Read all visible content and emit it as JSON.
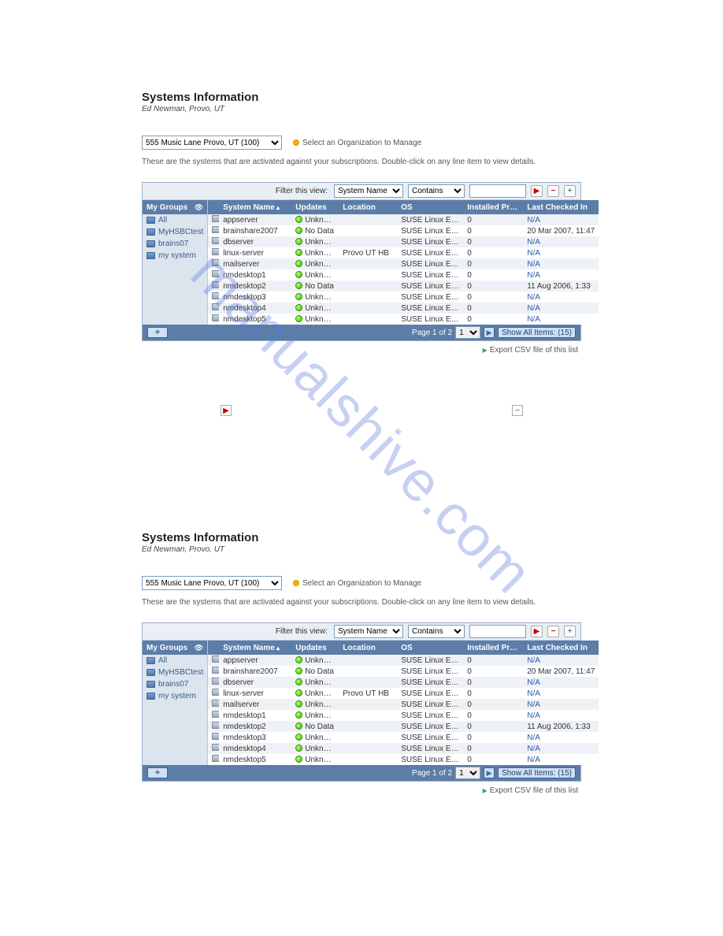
{
  "watermark": "manualshive.com",
  "header": {
    "title": "Systems Information",
    "subtitle": "Ed Newman, Provo, UT"
  },
  "org": {
    "selected": "555 Music Lane Provo, UT (100)",
    "hint": "Select an Organization to Manage"
  },
  "description": "These are the systems that are activated against your subscriptions. Double-click on any line item to view details.",
  "filter": {
    "label": "Filter this view:",
    "field": "System Name",
    "op": "Contains",
    "value": ""
  },
  "sidebar": {
    "title": "My Groups",
    "items": [
      "All",
      "MyHSBCtest",
      "brains07",
      "my system"
    ]
  },
  "columns": {
    "name": "System Name",
    "updates": "Updates",
    "location": "Location",
    "os": "OS",
    "products": "Installed Products",
    "last": "Last Checked In"
  },
  "rows": [
    {
      "name": "appserver",
      "updates": "Unknown",
      "location": "",
      "os": "SUSE Linux Enterp...",
      "products": "0",
      "last": "N/A"
    },
    {
      "name": "brainshare2007",
      "updates": "No Data",
      "location": "",
      "os": "SUSE Linux Enterp...",
      "products": "0",
      "last": "20 Mar 2007, 11:47"
    },
    {
      "name": "dbserver",
      "updates": "Unknown",
      "location": "",
      "os": "SUSE Linux Enterp...",
      "products": "0",
      "last": "N/A"
    },
    {
      "name": "linux-server",
      "updates": "Unknown",
      "location": "Provo UT HB",
      "os": "SUSE Linux Enterp...",
      "products": "0",
      "last": "N/A"
    },
    {
      "name": "mailserver",
      "updates": "Unknown",
      "location": "",
      "os": "SUSE Linux Enterp...",
      "products": "0",
      "last": "N/A"
    },
    {
      "name": "nmdesktop1",
      "updates": "Unknown",
      "location": "",
      "os": "SUSE Linux Enterp...",
      "products": "0",
      "last": "N/A"
    },
    {
      "name": "nmdesktop2",
      "updates": "No Data",
      "location": "",
      "os": "SUSE Linux Enterp...",
      "products": "0",
      "last": "11 Aug 2006, 1:33"
    },
    {
      "name": "nmdesktop3",
      "updates": "Unknown",
      "location": "",
      "os": "SUSE Linux Enterp...",
      "products": "0",
      "last": "N/A"
    },
    {
      "name": "nmdesktop4",
      "updates": "Unknown",
      "location": "",
      "os": "SUSE Linux Enterp...",
      "products": "0",
      "last": "N/A"
    },
    {
      "name": "nmdesktop5",
      "updates": "Unknown",
      "location": "",
      "os": "SUSE Linux Enterp...",
      "products": "0",
      "last": "N/A"
    }
  ],
  "pager": {
    "text": "Page 1 of 2",
    "value": "1",
    "show_all": "Show All Items: (15)"
  },
  "export": "Export CSV file of this list"
}
